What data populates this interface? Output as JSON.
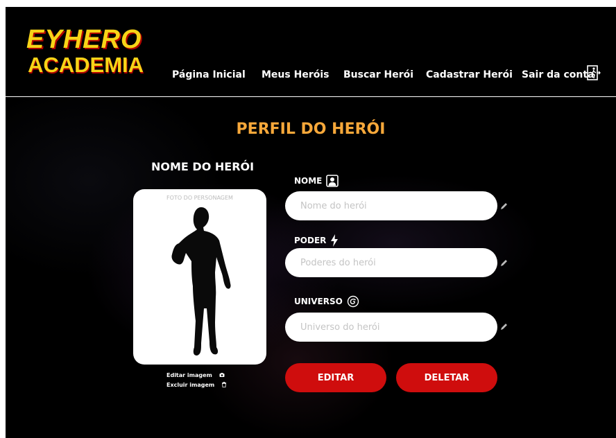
{
  "brand": {
    "logo_line1": "EYHERO",
    "logo_line2": "ACADEMIA"
  },
  "nav": {
    "items": [
      {
        "label": "Página Inicial"
      },
      {
        "label": "Meus Heróis"
      },
      {
        "label": "Buscar Herói"
      },
      {
        "label": "Cadastrar Herói"
      },
      {
        "label": "Sair da conta"
      }
    ],
    "logout_icon": "exit-door-icon"
  },
  "page": {
    "title": "PERFIL DO HERÓI",
    "hero_name": "NOME DO HERÓI"
  },
  "photo": {
    "caption": "FOTO DO PERSONAGEM",
    "edit_label": "Editar imagem",
    "edit_icon": "camera-icon",
    "delete_label": "Excluir imagem",
    "delete_icon": "trash-icon"
  },
  "form": {
    "name": {
      "label": "NOME",
      "icon": "person-portrait-icon",
      "placeholder": "Nome do herói",
      "value": ""
    },
    "power": {
      "label": "PODER",
      "icon": "lightning-icon",
      "placeholder": "Poderes do herói",
      "value": ""
    },
    "universe": {
      "label": "UNIVERSO",
      "icon": "spiral-galaxy-icon",
      "placeholder": "Universo do herói",
      "value": ""
    }
  },
  "actions": {
    "edit_label": "EDITAR",
    "delete_label": "DELETAR"
  },
  "colors": {
    "accent": "#f7a83a",
    "brand_yellow": "#f7d417",
    "button_red": "#cf0d0d",
    "background": "#000000"
  }
}
